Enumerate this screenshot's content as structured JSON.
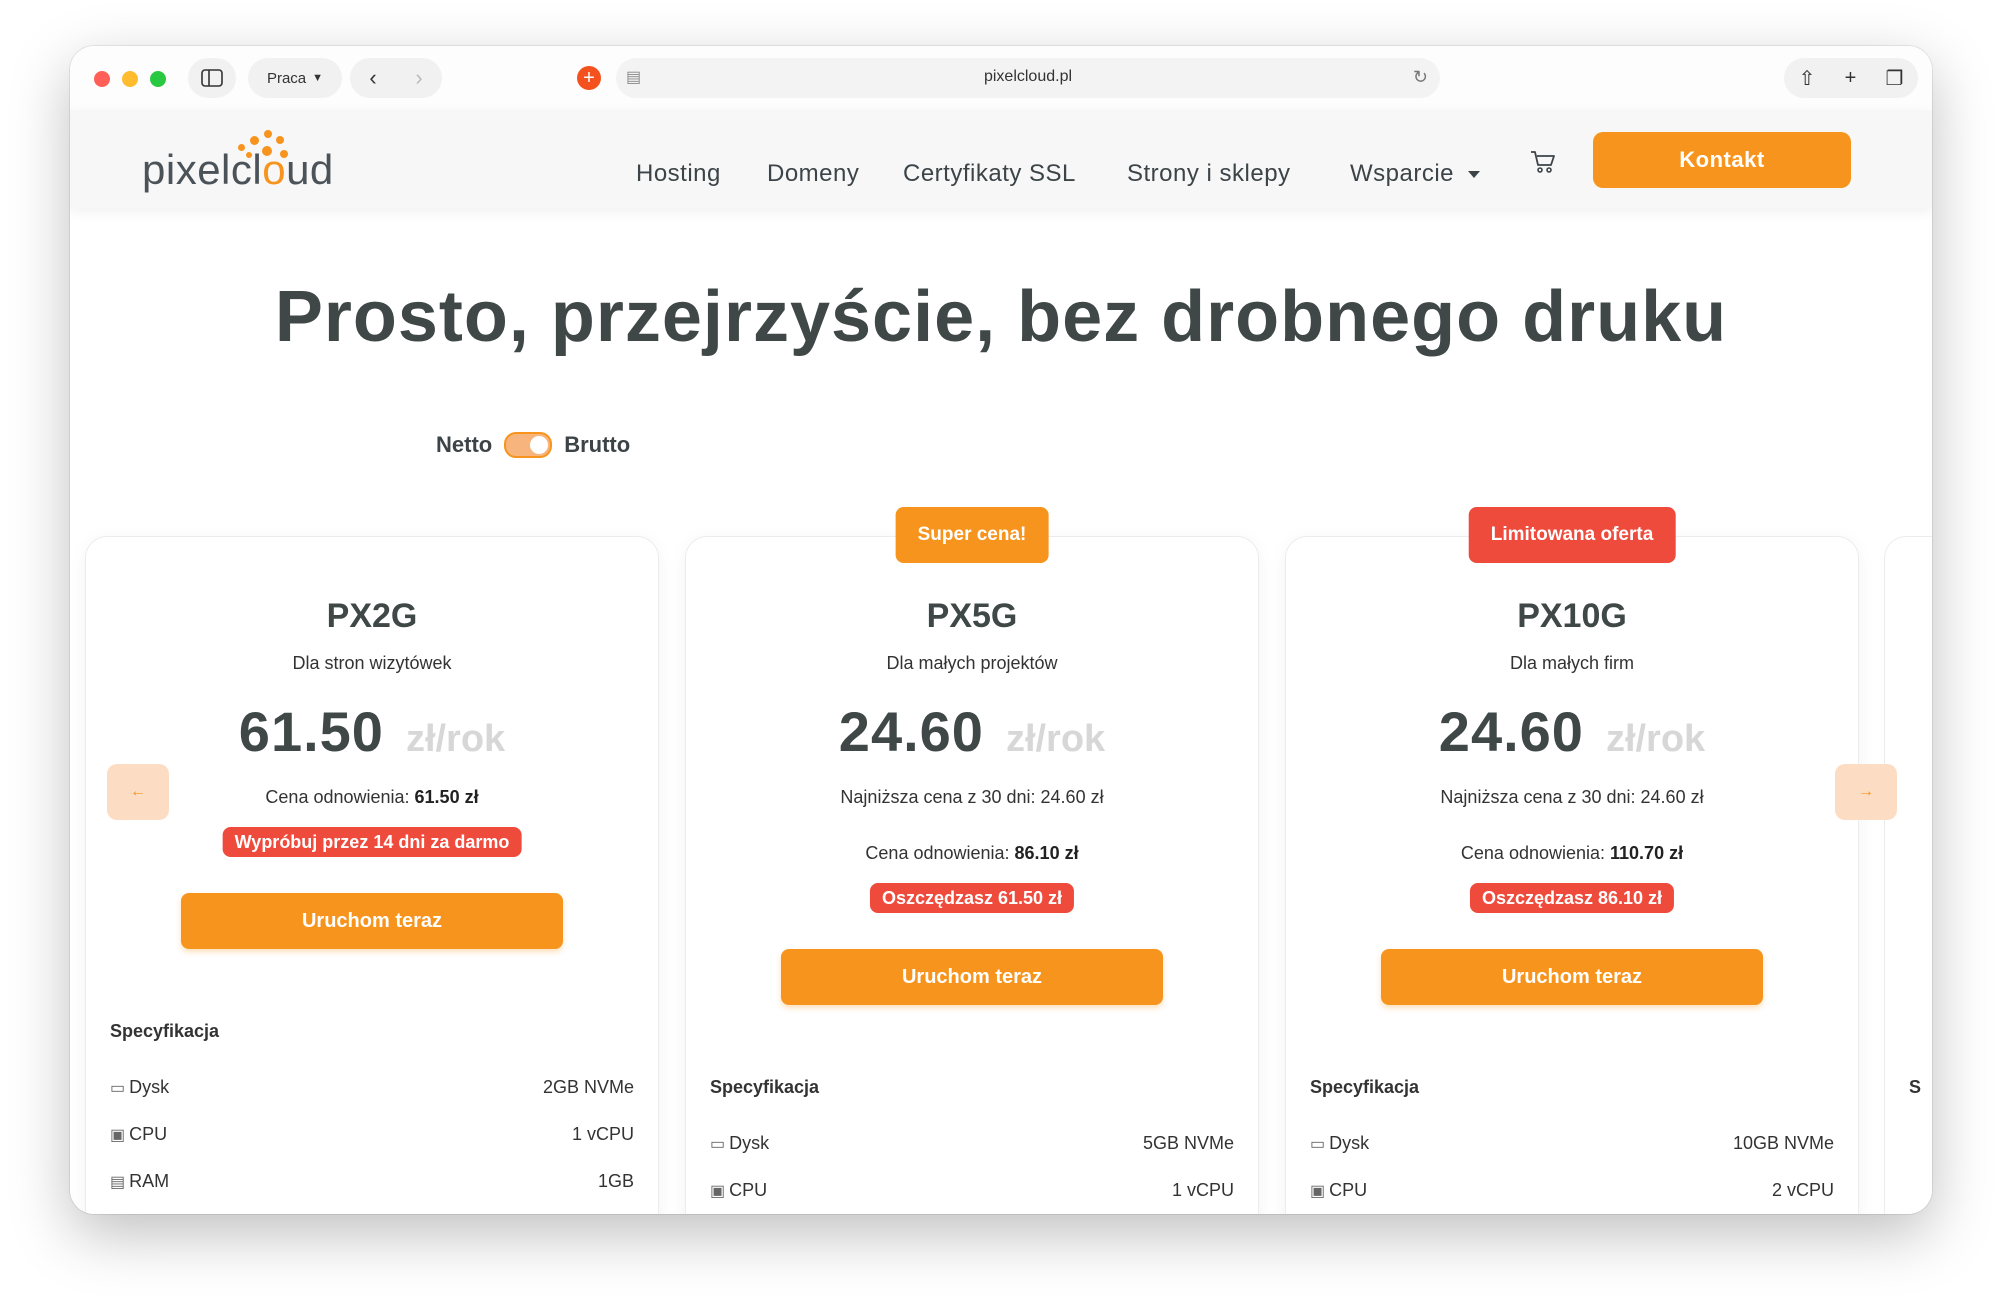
{
  "browser": {
    "profile": "Praca",
    "url": "pixelcloud.pl"
  },
  "site": {
    "logo_text_before": "pixelcl",
    "logo_text_o": "o",
    "logo_text_after": "ud",
    "nav": [
      "Hosting",
      "Domeny",
      "Certyfikaty SSL",
      "Strony i sklepy",
      "Wsparcie"
    ],
    "contact_label": "Kontakt"
  },
  "hero": {
    "title": "Prosto, przejrzyście, bez drobnego druku"
  },
  "price_toggle": {
    "left": "Netto",
    "right": "Brutto",
    "state": "on"
  },
  "plans": [
    {
      "badge": "",
      "name": "PX2G",
      "desc": "Dla stron wizytówek",
      "price": "61.50",
      "unit": "zł/rok",
      "lowest": "",
      "renewal_label": "Cena odnowienia: ",
      "renewal_value": "61.50 zł",
      "promo": "Wypróbuj przez 14 dni za darmo",
      "cta": "Uruchom teraz",
      "spec_title": "Specyfikacja",
      "specs": [
        {
          "label": "Dysk",
          "value": "2GB NVMe"
        },
        {
          "label": "CPU",
          "value": "1 vCPU"
        },
        {
          "label": "RAM",
          "value": "1GB"
        }
      ]
    },
    {
      "badge": "Super cena!",
      "name": "PX5G",
      "desc": "Dla małych projektów",
      "price": "24.60",
      "unit": "zł/rok",
      "lowest": "Najniższa cena z 30 dni: 24.60 zł",
      "renewal_label": "Cena odnowienia: ",
      "renewal_value": "86.10 zł",
      "promo": "Oszczędzasz 61.50 zł",
      "cta": "Uruchom teraz",
      "spec_title": "Specyfikacja",
      "specs": [
        {
          "label": "Dysk",
          "value": "5GB NVMe"
        },
        {
          "label": "CPU",
          "value": "1 vCPU"
        }
      ]
    },
    {
      "badge": "Limitowana oferta",
      "name": "PX10G",
      "desc": "Dla małych firm",
      "price": "24.60",
      "unit": "zł/rok",
      "lowest": "Najniższa cena z 30 dni: 24.60 zł",
      "renewal_label": "Cena odnowienia: ",
      "renewal_value": "110.70 zł",
      "promo": "Oszczędzasz 86.10 zł",
      "cta": "Uruchom teraz",
      "spec_title": "Specyfikacja",
      "specs": [
        {
          "label": "Dysk",
          "value": "10GB NVMe"
        },
        {
          "label": "CPU",
          "value": "2 vCPU"
        }
      ]
    }
  ],
  "partial_card": {
    "spec_initial": "S"
  },
  "colors": {
    "accent": "#f7941d",
    "badge_red": "#ef4b3d",
    "text_dark": "#3f4747"
  }
}
